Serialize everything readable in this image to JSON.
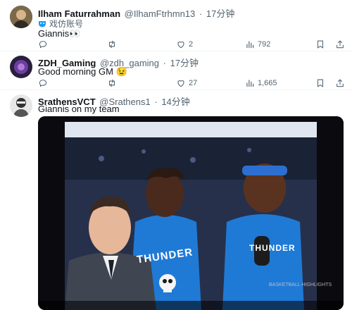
{
  "tweets": [
    {
      "display_name": "Ilham Faturrahman",
      "handle": "@IlhamFtrhmn13",
      "time": "17分钟",
      "badge": "戏仿账号",
      "text": "Giannis👀",
      "stats": {
        "reply": "",
        "retweet": "",
        "like": "2",
        "views": "792"
      }
    },
    {
      "display_name": "ZDH_Gaming",
      "handle": "@zdh_gaming",
      "time": "17分钟",
      "text": "Good morning GM 😉",
      "stats": {
        "reply": "",
        "retweet": "",
        "like": "27",
        "views": "1,665"
      }
    },
    {
      "display_name": "SrathensVCT",
      "handle": "@Srathens1",
      "time": "14分钟",
      "text": "Giannis on my team",
      "media": {
        "jersey_text": "THUNDER",
        "watermark": "BASKETBALL HIGHLIGHTS"
      }
    }
  ],
  "separator": "·",
  "colors": {
    "text": "#0f1419",
    "muted": "#536471",
    "divider": "#eff3f4",
    "thunder_blue": "#1f7ad6"
  },
  "icons": [
    "reply-icon",
    "retweet-icon",
    "like-icon",
    "views-icon",
    "bookmark-icon",
    "share-icon",
    "parody-mask-icon"
  ]
}
